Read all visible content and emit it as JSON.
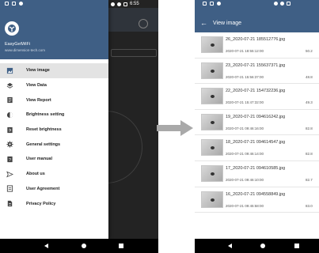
{
  "left_phone": {
    "status_time": "6:55",
    "drawer": {
      "app_name": "EasyGetWiFi",
      "app_url": "www.dimension-tech.com",
      "items": [
        {
          "label": "View image",
          "icon": "image-icon",
          "active": true
        },
        {
          "label": "View Data",
          "icon": "layers-icon",
          "active": false
        },
        {
          "label": "View Report",
          "icon": "report-icon",
          "active": false
        },
        {
          "label": "Brightness setting",
          "icon": "brightness-icon",
          "active": false
        },
        {
          "label": "Reset brightness",
          "icon": "reset-icon",
          "active": false
        },
        {
          "label": "General settings",
          "icon": "gear-icon",
          "active": false
        },
        {
          "label": "User manual",
          "icon": "manual-icon",
          "active": false
        },
        {
          "label": "About us",
          "icon": "send-icon",
          "active": false
        },
        {
          "label": "User Agreement",
          "icon": "agreement-icon",
          "active": false
        },
        {
          "label": "Privacy Policy",
          "icon": "privacy-icon",
          "active": false
        }
      ]
    }
  },
  "right_phone": {
    "title": "View image",
    "back_icon": "←",
    "images": [
      {
        "name": "26_2020-07-21 185512776.jpg",
        "date": "2020-07-21 18:55:12:00",
        "value": "50.2"
      },
      {
        "name": "23_2020-07-21 155637371.jpg",
        "date": "2020-07-21 15:56:37:00",
        "value": "48.8"
      },
      {
        "name": "22_2020-07-21 154732236.jpg",
        "date": "2020-07-21 15:47:32:00",
        "value": "49.3"
      },
      {
        "name": "19_2020-07-21 094616242.jpg",
        "date": "2020-07-21 09:46:16:00",
        "value": "82.8"
      },
      {
        "name": "18_2020-07-21 094614547.jpg",
        "date": "2020-07-21 09:46:14:00",
        "value": "82.8"
      },
      {
        "name": "17_2020-07-21 094610585.jpg",
        "date": "2020-07-21 09:46:10:00",
        "value": "82.7"
      },
      {
        "name": "16_2020-07-21 094558849.jpg",
        "date": "2020-07-21 09:45:58:00",
        "value": "83.0"
      }
    ]
  },
  "colors": {
    "header": "#3f5f85",
    "nav_bar": "#000000",
    "active_item": "#e3e3e3"
  }
}
